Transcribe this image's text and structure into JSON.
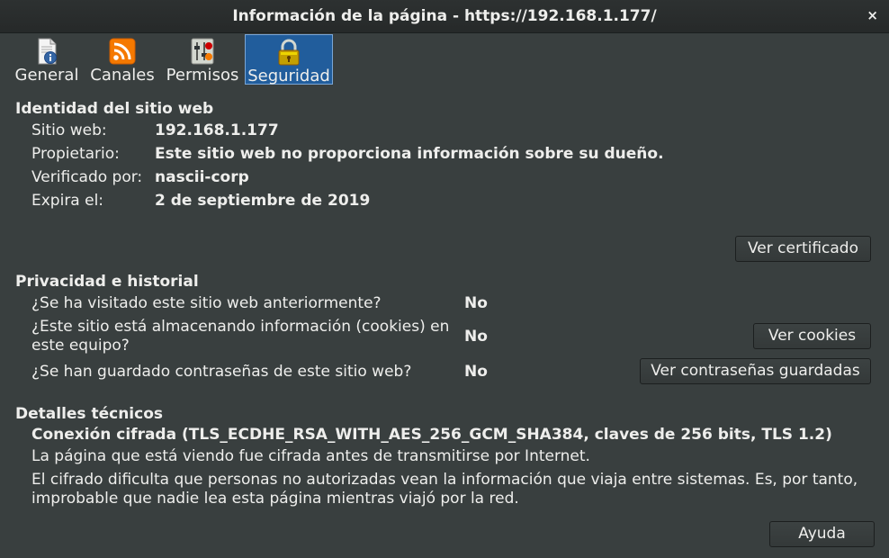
{
  "window": {
    "title": "Información de la página - https://192.168.1.177/",
    "close_glyph": "×"
  },
  "tabs": [
    {
      "label": "General",
      "icon": "page-info-icon",
      "active": false
    },
    {
      "label": "Canales",
      "icon": "rss-feed-icon",
      "active": false
    },
    {
      "label": "Permisos",
      "icon": "permissions-icon",
      "active": false
    },
    {
      "label": "Seguridad",
      "icon": "padlock-icon",
      "active": true
    }
  ],
  "identity": {
    "heading": "Identidad del sitio web",
    "website_label": "Sitio web:",
    "website_value": "192.168.1.177",
    "owner_label": "Propietario:",
    "owner_value": "Este sitio web no proporciona información sobre su dueño.",
    "verified_label": "Verificado por:",
    "verified_value": "nascii-corp",
    "expires_label": "Expira el:",
    "expires_value": "2 de septiembre de 2019",
    "view_certificate": "Ver certificado"
  },
  "privacy": {
    "heading": "Privacidad e historial",
    "visited_q": "¿Se ha visitado este sitio web anteriormente?",
    "visited_a": "No",
    "cookies_q_line1": "¿Este sitio está almacenando información (cookies) en",
    "cookies_q_line2": "este equipo?",
    "cookies_a": "No",
    "view_cookies": "Ver cookies",
    "passwords_q": "¿Se han guardado contraseñas de este sitio web?",
    "passwords_a": "No",
    "view_passwords": "Ver contraseñas guardadas"
  },
  "technical": {
    "heading": "Detalles técnicos",
    "connection": "Conexión cifrada (TLS_ECDHE_RSA_WITH_AES_256_GCM_SHA384, claves de 256 bits, TLS 1.2)",
    "line1": "La página que está viendo fue cifrada antes de transmitirse por Internet.",
    "line2": "El cifrado dificulta que personas no autorizadas vean la información que viaja entre sistemas. Es, por tanto,",
    "line3": "improbable que nadie lea esta página mientras viajó por la red."
  },
  "help_button": "Ayuda",
  "colors": {
    "background": "#393f3f",
    "active_tab": "#215d9c",
    "text": "#eeeeec"
  }
}
